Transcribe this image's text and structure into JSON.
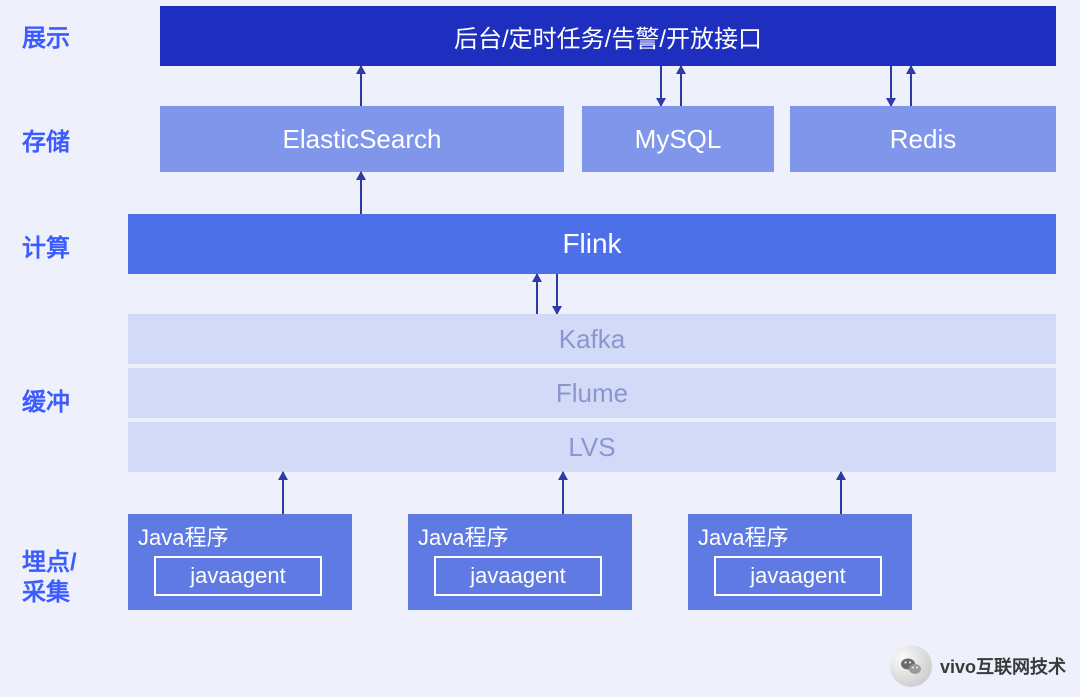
{
  "labels": {
    "display": "展示",
    "storage": "存储",
    "compute": "计算",
    "buffer": "缓冲",
    "collect": "埋点/\n采集"
  },
  "tier_display": "后台/定时任务/告警/开放接口",
  "storage": {
    "es": "ElasticSearch",
    "mysql": "MySQL",
    "redis": "Redis"
  },
  "compute": "Flink",
  "buffer": {
    "kafka": "Kafka",
    "flume": "Flume",
    "lvs": "LVS"
  },
  "collect": {
    "card_title": "Java程序",
    "inner": "javaagent"
  },
  "watermark": "vivo互联网技术",
  "colors": {
    "bg": "#eef1fc",
    "royal": "#1e2fbf",
    "medium": "#7f96ea",
    "solid": "#4d6fe8",
    "pale": "#d2daf7",
    "palefg": "#8a97cf",
    "card": "#5f7be3",
    "label": "#3d5cff"
  }
}
